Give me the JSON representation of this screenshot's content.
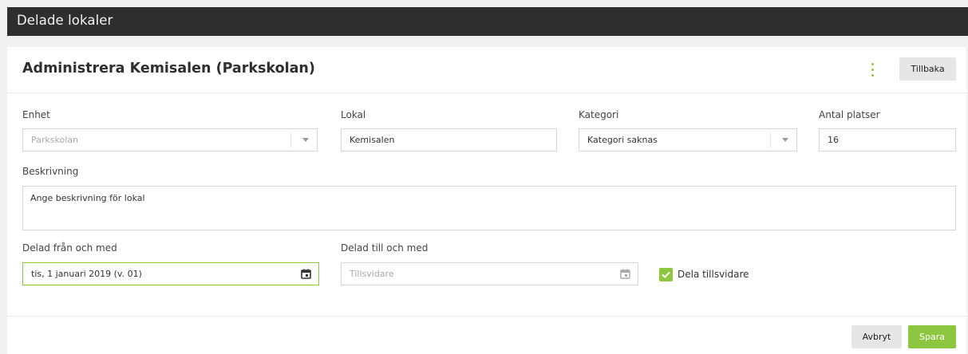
{
  "app": {
    "title": "Delade lokaler"
  },
  "header": {
    "title": "Administrera Kemisalen (Parkskolan)",
    "back_label": "Tillbaka"
  },
  "form": {
    "enhet": {
      "label": "Enhet",
      "value": "Parkskolan"
    },
    "lokal": {
      "label": "Lokal",
      "value": "Kemisalen"
    },
    "kategori": {
      "label": "Kategori",
      "value": "Kategori saknas"
    },
    "antal": {
      "label": "Antal platser",
      "value": "16"
    },
    "beskrivning": {
      "label": "Beskrivning",
      "placeholder": "Ange beskrivning för lokal"
    },
    "fran": {
      "label": "Delad från och med",
      "value": "tis, 1 januari 2019 (v. 01)"
    },
    "till": {
      "label": "Delad till och med",
      "placeholder": "Tillsvidare"
    },
    "tillsvidare": {
      "label": "Dela tillsvidare",
      "checked": true
    }
  },
  "footer": {
    "cancel_label": "Avbryt",
    "save_label": "Spara"
  },
  "colors": {
    "accent": "#8dc63f",
    "topbar": "#2e2e2e"
  }
}
